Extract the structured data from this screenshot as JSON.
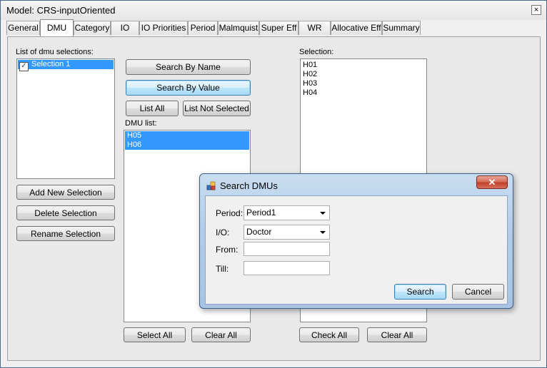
{
  "window": {
    "title": "Model: CRS-inputOriented",
    "close_glyph": "×"
  },
  "tabs": [
    "General",
    "DMU",
    "Category",
    "IO",
    "IO Priorities",
    "Period",
    "Malmquist",
    "Super Eff",
    "WR",
    "Allocative Eff",
    "Summary"
  ],
  "active_tab": "DMU",
  "selections": {
    "label": "List of dmu selections:",
    "items": [
      {
        "label": "Selection 1",
        "checked": true,
        "selected": true
      }
    ],
    "add_label": "Add New Selection",
    "delete_label": "Delete Selection",
    "rename_label": "Rename Selection"
  },
  "search": {
    "by_name_label": "Search By Name",
    "by_value_label": "Search By Value",
    "list_all_label": "List All",
    "list_not_selected_label": "List Not Selected"
  },
  "dmu_list": {
    "label": "DMU list:",
    "items": [
      "H05",
      "H06"
    ],
    "select_all_label": "Select All",
    "clear_all_label": "Clear All"
  },
  "selection": {
    "label": "Selection:",
    "items": [
      "H01",
      "H02",
      "H03",
      "H04"
    ],
    "check_all_label": "Check All",
    "clear_all_label": "Clear All"
  },
  "dialog": {
    "title": "Search DMUs",
    "period_label": "Period:",
    "period_value": "Period1",
    "io_label": "I/O:",
    "io_value": "Doctor",
    "from_label": "From:",
    "from_value": "",
    "till_label": "Till:",
    "till_value": "",
    "search_label": "Search",
    "cancel_label": "Cancel",
    "close_glyph": "✕"
  },
  "colors": {
    "selection": "#3399ff",
    "dialog_frame": "#b3cde8",
    "close_red": "#c1412a"
  }
}
